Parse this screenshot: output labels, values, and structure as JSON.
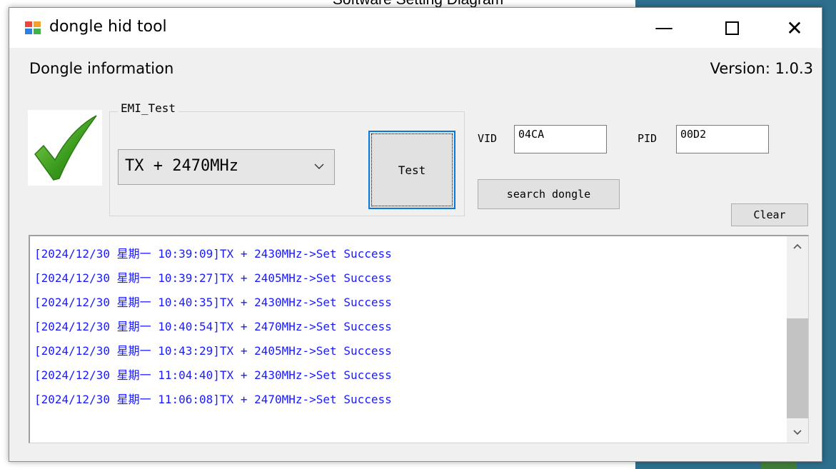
{
  "caption": "Software Setting Diagram",
  "window": {
    "title": "dongle hid tool",
    "minimize_glyph": "—",
    "close_glyph": "✕"
  },
  "info": {
    "label": "Dongle information",
    "version": "Version: 1.0.3"
  },
  "status_icon": "checkmark-icon",
  "emi": {
    "group_title": "EMI_Test",
    "selected": "TX + 2470MHz",
    "test_label": "Test"
  },
  "ids": {
    "vid_label": "VID",
    "vid_value": "04CA",
    "pid_label": "PID",
    "pid_value": "00D2"
  },
  "buttons": {
    "search": "search dongle",
    "clear": "Clear"
  },
  "log": [
    "[2024/12/30 星期一 10:39:09]TX + 2430MHz->Set Success",
    "[2024/12/30 星期一 10:39:27]TX + 2405MHz->Set Success",
    "[2024/12/30 星期一 10:40:35]TX + 2430MHz->Set Success",
    "[2024/12/30 星期一 10:40:54]TX + 2470MHz->Set Success",
    "[2024/12/30 星期一 10:43:29]TX + 2405MHz->Set Success",
    "[2024/12/30 星期一 11:04:40]TX + 2430MHz->Set Success",
    "[2024/12/30 星期一 11:06:08]TX + 2470MHz->Set Success"
  ],
  "colors": {
    "log_text": "#1a1aff",
    "accent": "#0a78d7",
    "check_green": "#3c9d1e"
  }
}
